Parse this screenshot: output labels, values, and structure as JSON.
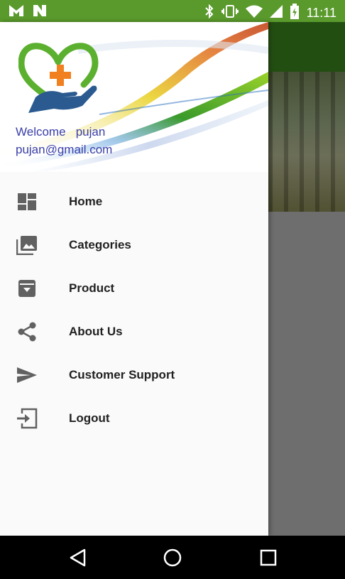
{
  "status_bar": {
    "time": "11:11",
    "left_icons": [
      "notification-m-icon",
      "notification-n-icon"
    ],
    "right_icons": [
      "bluetooth-icon",
      "vibrate-icon",
      "wifi-icon",
      "signal-icon",
      "battery-icon"
    ],
    "color": "#5a9a2c"
  },
  "drawer": {
    "header": {
      "welcome": "Welcome   pujan",
      "email": "pujan@gmail.com",
      "text_color": "#3a3fa8"
    },
    "items": [
      {
        "label": "Home",
        "icon": "dashboard-icon"
      },
      {
        "label": "Categories",
        "icon": "photo-library-icon"
      },
      {
        "label": "Product",
        "icon": "archive-icon"
      },
      {
        "label": "About Us",
        "icon": "share-icon"
      },
      {
        "label": "Customer Support",
        "icon": "send-icon"
      },
      {
        "label": "Logout",
        "icon": "login-icon"
      }
    ]
  },
  "app": {
    "toolbar_color": "#234e12"
  },
  "nav_bar": {
    "buttons": [
      "back-icon",
      "home-icon",
      "recents-icon"
    ]
  }
}
